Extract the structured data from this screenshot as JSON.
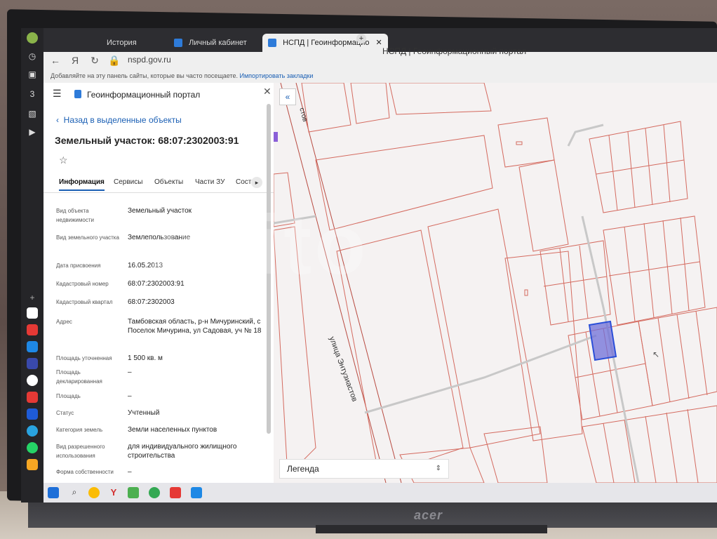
{
  "tabs": [
    {
      "label": "История"
    },
    {
      "label": "Личный кабинет"
    },
    {
      "label": "НСПД | Геоинформацио"
    }
  ],
  "address": {
    "url": "nspd.gov.ru",
    "page_title": "НСПД | Геоинформационный портал"
  },
  "bookmarks": {
    "hint": "Добавляйте на эту панель сайты, которые вы часто посещаете.",
    "import_link": "Импортировать закладки"
  },
  "panel": {
    "portal_title": "Геоинформационный портал",
    "back_label": "Назад в выделенные объекты",
    "parcel_title": "Земельный участок: 68:07:2302003:91",
    "tabs": [
      "Информация",
      "Сервисы",
      "Объекты",
      "Части ЗУ",
      "Соста"
    ],
    "fields": [
      {
        "label": "Вид объекта недвижимости",
        "value": "Земельный участок"
      },
      {
        "label": "Вид земельного участка",
        "value": "Землепользование"
      },
      {
        "label": "Дата присвоения",
        "value": "16.05.2013"
      },
      {
        "label": "Кадастровый номер",
        "value": "68:07:2302003:91"
      },
      {
        "label": "Кадастровый квартал",
        "value": "68:07:2302003"
      },
      {
        "label": "Адрес",
        "value": "Тамбовская область, р-н Мичуринский, с Поселок Мичурина, ул Садовая, уч № 18"
      },
      {
        "label": "Площадь уточненная",
        "value": "1 500 кв. м"
      },
      {
        "label": "Площадь декларированная",
        "value": "–"
      },
      {
        "label": "Площадь",
        "value": "–"
      },
      {
        "label": "Статус",
        "value": "Учтенный"
      },
      {
        "label": "Категория земель",
        "value": "Земли населенных пунктов"
      },
      {
        "label": "Вид разрешенного использования",
        "value": "для индивидуального жилищного строительства"
      },
      {
        "label": "Форма собственности",
        "value": "–"
      }
    ]
  },
  "map": {
    "street_label": "улица Энтузиастов",
    "street_label_top": "стов",
    "legend": "Легенда"
  },
  "screen": {
    "watermark": "Avito",
    "monitor_brand": "acer"
  },
  "colors": {
    "parcel_border": "#d46a5f",
    "selected_fill": "#6f6fd8",
    "selected_border": "#2b4fd8",
    "accent": "#1a5fb4"
  }
}
